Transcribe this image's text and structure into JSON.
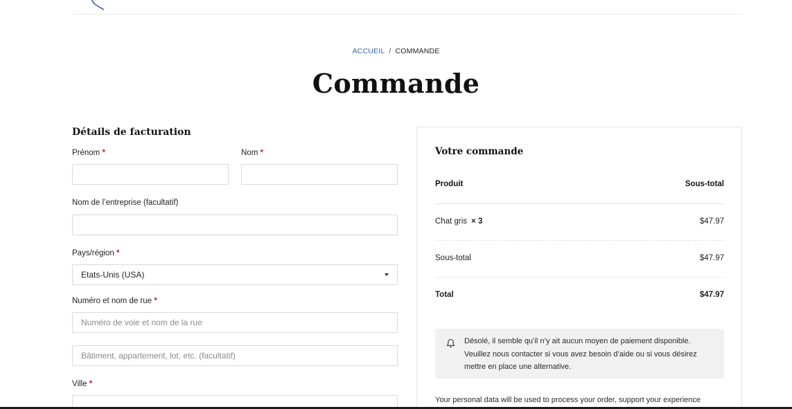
{
  "breadcrumb": {
    "home": "ACCUEIL",
    "separator": "/",
    "current": "COMMANDE"
  },
  "page": {
    "title": "Commande"
  },
  "billing": {
    "title": "Détails de facturation",
    "required_mark": "*",
    "first_name": {
      "label": "Prénom",
      "value": ""
    },
    "last_name": {
      "label": "Nom",
      "value": ""
    },
    "company": {
      "label": "Nom de l’entreprise (facultatif)",
      "value": ""
    },
    "country": {
      "label": "Pays/région",
      "value": "Etats-Unis (USA)"
    },
    "street": {
      "label": "Numéro et nom de rue",
      "placeholder": "Numéro de voie et nom de la rue",
      "placeholder2": "Bâtiment, appartement, lot, etc. (facultatif)"
    },
    "city": {
      "label": "Ville"
    }
  },
  "order": {
    "title": "Votre commande",
    "col_product": "Produit",
    "col_subtotal": "Sous-total",
    "items": [
      {
        "name": "Chat gris",
        "qty": "× 3",
        "price": "$47.97"
      }
    ],
    "subtotal_label": "Sous-total",
    "subtotal_value": "$47.97",
    "total_label": "Total",
    "total_value": "$47.97",
    "notice": "Désolé, il semble qu’il n’y ait aucun moyen de paiement disponible. Veuillez nous contacter si vous avez besoin d’aide ou si vous désirez mettre en place une alternative.",
    "privacy": "Your personal data will be used to process your order, support your experience"
  },
  "colors": {
    "required": "#c0212b",
    "link": "#2f5fb0",
    "notice_bg": "#f1f1f2"
  },
  "icons": {
    "notice": "bell-icon",
    "select": "chevron-down-icon"
  }
}
